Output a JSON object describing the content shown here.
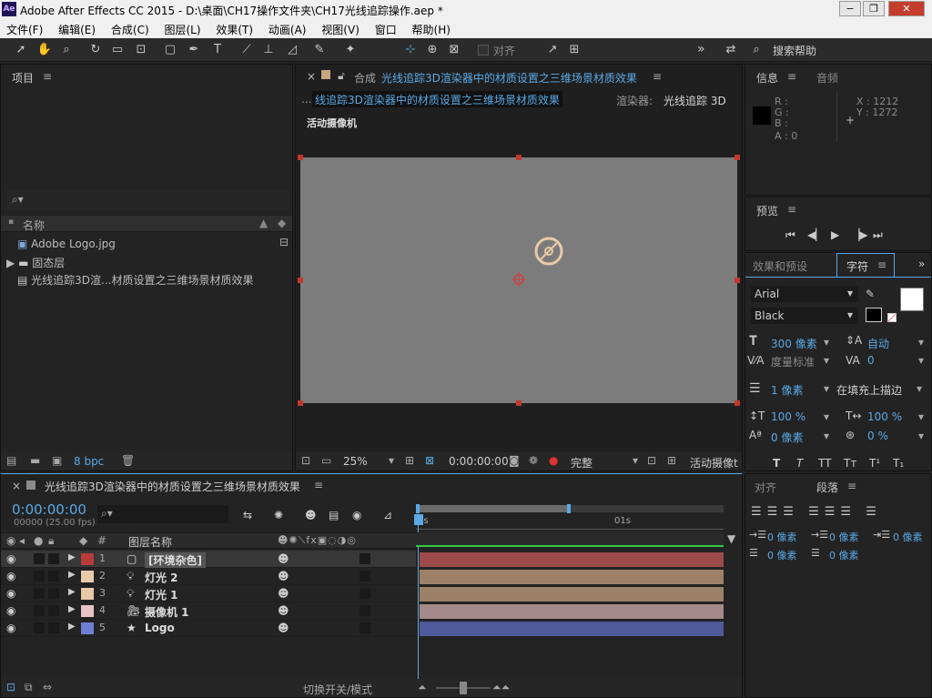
{
  "window": {
    "title": "Adobe After Effects CC 2015 - D:\\桌面\\CH17操作文件夹\\CH17光线追踪操作.aep *",
    "logo_text": "Ae",
    "minimize": "−",
    "restore": "❐",
    "close": "✕"
  },
  "menu": [
    "文件(F)",
    "编辑(E)",
    "合成(C)",
    "图层(L)",
    "效果(T)",
    "动画(A)",
    "视图(V)",
    "窗口",
    "帮助(H)"
  ],
  "toolbar": {
    "snap_label": "对齐",
    "overflow": "»",
    "search_help": "搜索帮助"
  },
  "project": {
    "tab": "项目",
    "column_name": "名称",
    "items": [
      {
        "name": "Adobe Logo.jpg",
        "icon": "image-icon"
      },
      {
        "name": "固态层",
        "icon": "folder-icon"
      },
      {
        "name": "光线追踪3D渲...材质设置之三维场景材质效果",
        "icon": "composition-icon"
      }
    ],
    "bpc": "8 bpc"
  },
  "composition": {
    "tab_prefix": "合成",
    "tab_name": "光线追踪3D渲染器中的材质设置之三维场景材质效果",
    "breadcrumb": "线追踪3D渲染器中的材质设置之三维场景材质效果",
    "breadcrumb_prefix": "...",
    "renderer_label": "渲染器:",
    "renderer_value": "光线追踪 3D",
    "view_label": "活动摄像机",
    "zoom": "25%",
    "timecode": "0:00:00:00",
    "quality": "完整",
    "camera_view": "活动摄像t"
  },
  "info": {
    "tab_info": "信息",
    "tab_audio": "音频",
    "r": "R :",
    "g": "G :",
    "b": "B :",
    "a": "A : 0",
    "x": "X : 1212",
    "y": "Y : 1272"
  },
  "preview": {
    "tab": "预览"
  },
  "character": {
    "tab_effects": "效果和预设",
    "tab_char": "字符",
    "font": "Arial",
    "style": "Black",
    "size": "300 像素",
    "leading": "自动",
    "kerning": "度量标准",
    "tracking": "0",
    "stroke_width": "1 像素",
    "stroke_mode": "在填充上描边",
    "vscale": "100 %",
    "hscale": "100 %",
    "baseline": "0 像素",
    "tsume": "0 %",
    "styles": [
      "T",
      "T",
      "TT",
      "Tт",
      "T¹",
      "T₁"
    ]
  },
  "paragraph": {
    "tab_align": "对齐",
    "tab_para": "段落",
    "indent_left": "0 像素",
    "indent_first": "0 像素",
    "indent_right": "0 像素",
    "space_before": "0 像素",
    "space_after": "0 像素"
  },
  "timeline": {
    "comp_name": "光线追踪3D渲染器中的材质设置之三维场景材质效果",
    "timecode": "0:00:00:00",
    "frames": "00000 (25.00 fps)",
    "col_hash": "#",
    "col_layer_name": "图层名称",
    "ruler_start": "0s",
    "ruler_1s": "01s",
    "toggle_label": "切换开关/模式",
    "layers": [
      {
        "num": "1",
        "name": "[环境杂色]",
        "color": "#b83a3a",
        "bar": "#9c4a4a",
        "icon": "solid-icon"
      },
      {
        "num": "2",
        "name": "灯光 2",
        "color": "#e8c9a8",
        "bar": "#9c8068",
        "icon": "light-icon"
      },
      {
        "num": "3",
        "name": "灯光 1",
        "color": "#e8c9a8",
        "bar": "#9c8068",
        "icon": "light-icon"
      },
      {
        "num": "4",
        "name": "摄像机 1",
        "color": "#e8c3c6",
        "bar": "#a58a8a",
        "icon": "camera-icon"
      },
      {
        "num": "5",
        "name": "Logo",
        "color": "#6f7fd6",
        "bar": "#4f5a9a",
        "icon": "star-icon"
      }
    ]
  }
}
